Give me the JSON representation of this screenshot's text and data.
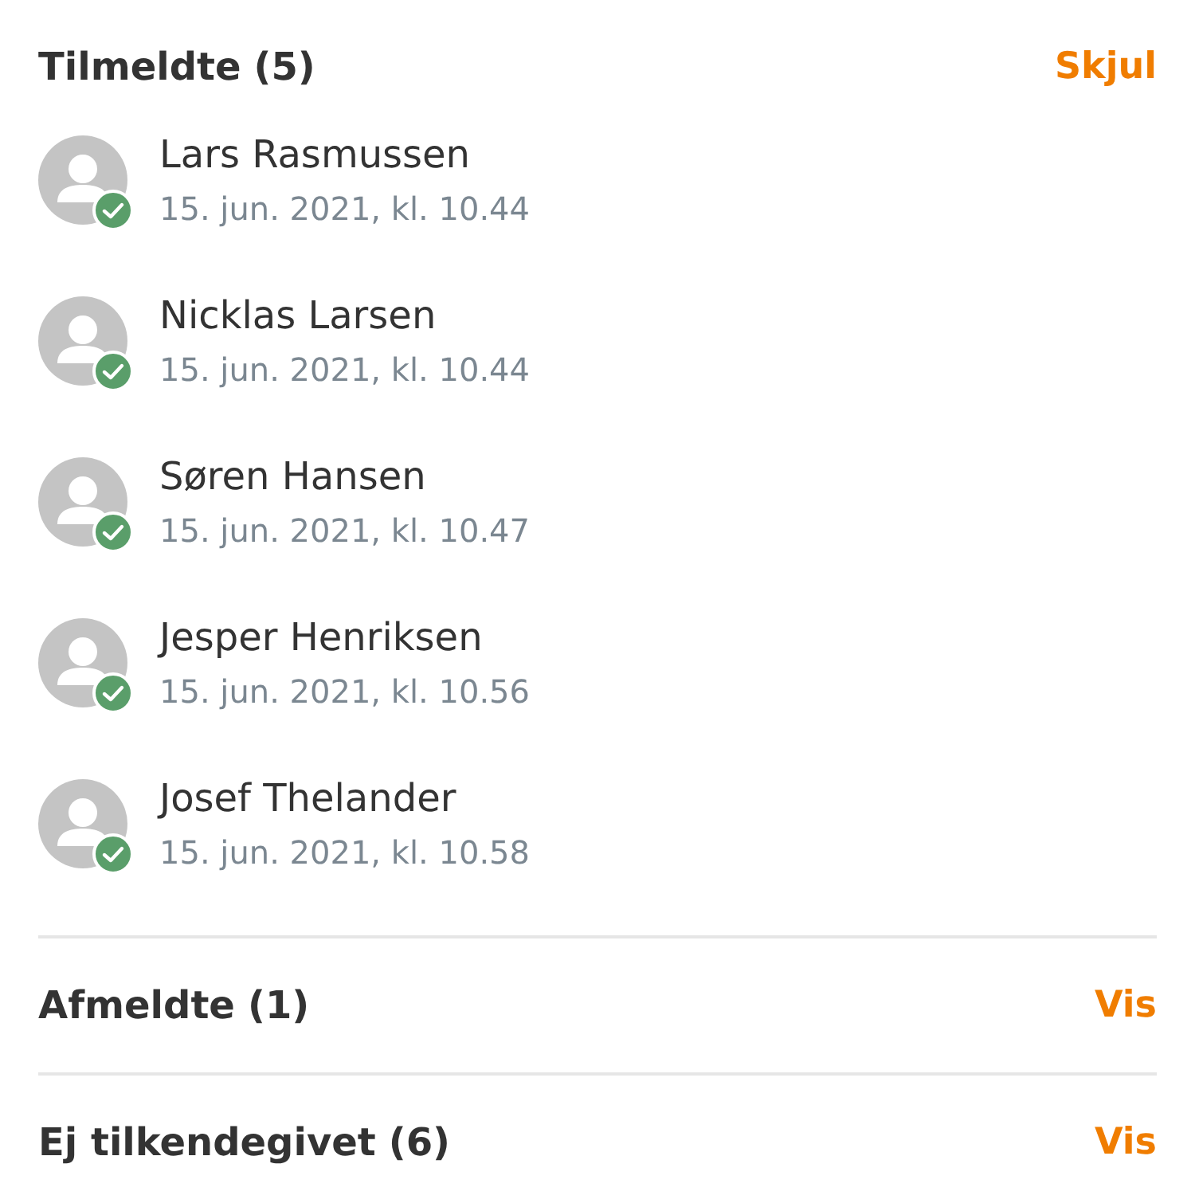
{
  "sections": [
    {
      "title": "Tilmeldte",
      "count": "(5)",
      "action": "Skjul",
      "expanded": true,
      "members": [
        {
          "name": "Lars Rasmussen",
          "date": "15. jun. 2021, kl. 10.44",
          "confirmed": true
        },
        {
          "name": "Nicklas Larsen",
          "date": "15. jun. 2021, kl. 10.44",
          "confirmed": true
        },
        {
          "name": "Søren Hansen",
          "date": "15. jun. 2021, kl. 10.47",
          "confirmed": true
        },
        {
          "name": "Jesper Henriksen",
          "date": "15. jun. 2021, kl. 10.56",
          "confirmed": true
        },
        {
          "name": "Josef Thelander",
          "date": "15. jun. 2021, kl. 10.58",
          "confirmed": true
        }
      ]
    },
    {
      "title": "Afmeldte",
      "count": "(1)",
      "action": "Vis",
      "expanded": false
    },
    {
      "title": "Ej tilkendegivet",
      "count": "(6)",
      "action": "Vis",
      "expanded": false
    }
  ]
}
